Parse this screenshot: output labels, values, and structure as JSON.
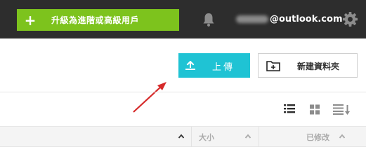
{
  "topbar": {
    "upgrade_plus": "+",
    "upgrade_label": "升級為進階或高級用戶",
    "email_visible": "@outlook.com",
    "colors": {
      "bar": "#2d2d2d",
      "upgrade": "#7dc31d"
    }
  },
  "toolbar": {
    "upload_label": "上傳",
    "new_folder_label": "新建資料夾",
    "colors": {
      "upload": "#1fc3d4"
    }
  },
  "view_icons": [
    "list-view-icon",
    "grid-view-icon",
    "sort-icon"
  ],
  "table_header": {
    "size_label": "大小",
    "modified_label": "已修改"
  },
  "annotation": {
    "arrow_color": "#d62a2a"
  }
}
